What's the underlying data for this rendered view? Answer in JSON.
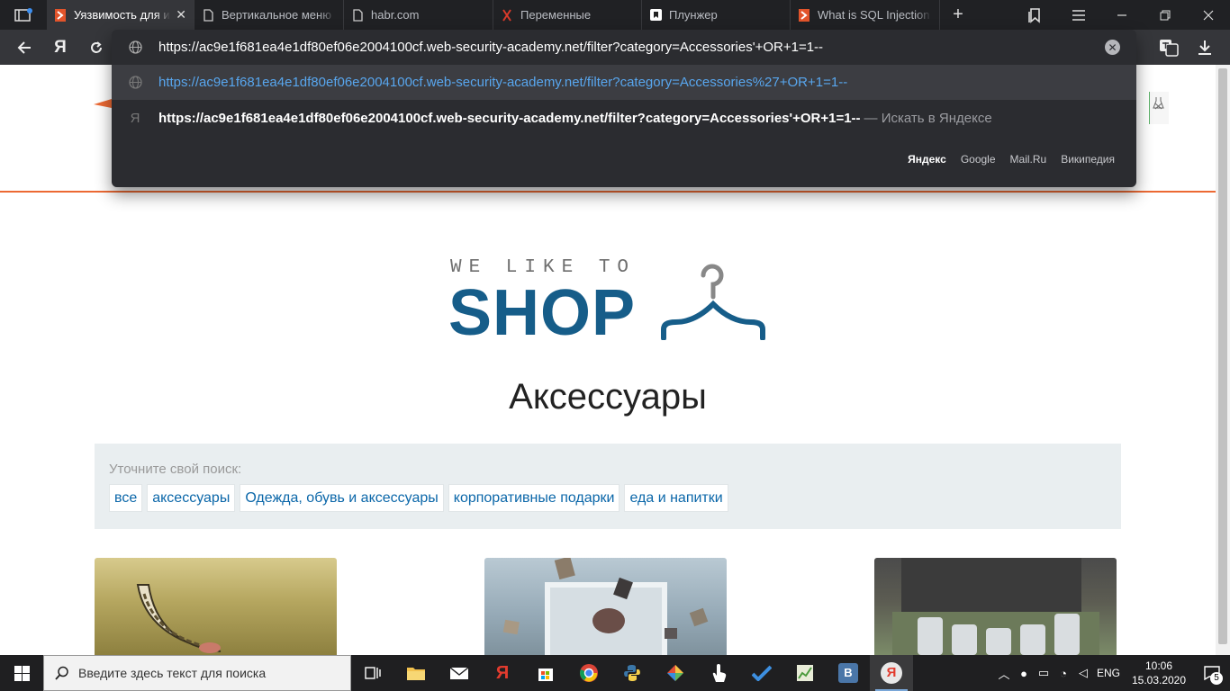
{
  "tabs": [
    {
      "title": "Уязвимость для иг",
      "active": true,
      "icon": "portswigger-icon"
    },
    {
      "title": "Вертикальное меню",
      "active": false,
      "icon": "page-icon"
    },
    {
      "title": "habr.com",
      "active": false,
      "icon": "page-icon"
    },
    {
      "title": "Переменные",
      "active": false,
      "icon": "portswigger-icon"
    },
    {
      "title": "Плунжер",
      "active": false,
      "icon": "bookmark-icon"
    },
    {
      "title": "What is SQL Injection",
      "active": false,
      "icon": "portswigger-icon"
    }
  ],
  "omnibox": {
    "input": "https://ac9e1f681ea4e1df80ef06e2004100cf.web-security-academy.net/filter?category=Accessories'+OR+1=1--",
    "suggestion_url": "https://ac9e1f681ea4e1df80ef06e2004100cf.web-security-academy.net/filter?category=Accessories%27+OR+1=1--",
    "suggestion_search": "https://ac9e1f681ea4e1df80ef06e2004100cf.web-security-academy.net/filter?category=Accessories'+OR+1=1--",
    "search_hint": "— Искать в Яндексе",
    "yandex_glyph": "Я",
    "engines": [
      "Яндекс",
      "Google",
      "Mail.Ru",
      "Википедия"
    ]
  },
  "toolbar": {
    "yandex_label": "Я"
  },
  "shop": {
    "logo_small": "WE LIKE TO",
    "logo_big": "SHOP",
    "heading": "Аксессуары",
    "filter_label": "Уточните свой поиск:",
    "filters": [
      "все",
      "аксессуары",
      "Одежда, обувь и аксессуары",
      "корпоративные подарки",
      "еда и напитки"
    ]
  },
  "taskbar": {
    "search_placeholder": "Введите здесь текст для поиска",
    "lang": "ENG",
    "time": "10:06",
    "date": "15.03.2020",
    "notif_count": "5",
    "vk_label": "В",
    "yandex_label": "Я",
    "ya_app_label": "Я"
  },
  "colors": {
    "accent_orange": "#ec6933",
    "shop_blue": "#165d89",
    "link_blue": "#0b67a9",
    "omni_link": "#58a6ee"
  }
}
